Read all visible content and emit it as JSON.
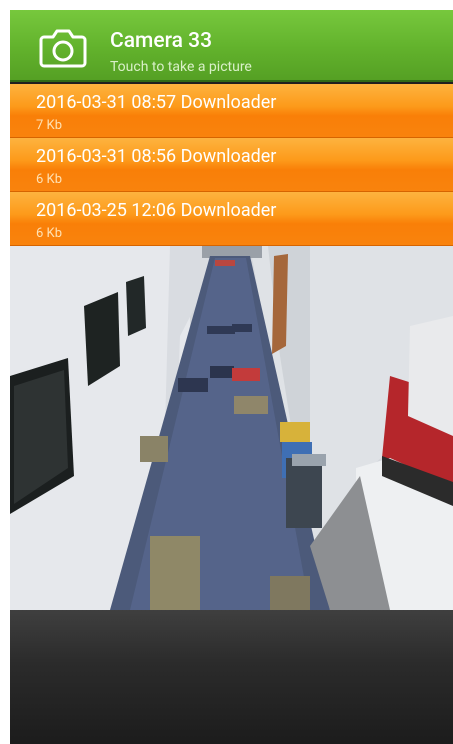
{
  "header": {
    "title": "Camera 33",
    "subtitle": "Touch to take a picture",
    "icon": "camera-icon"
  },
  "downloads": [
    {
      "title": "2016-03-31 08:57 Downloader",
      "size": "7 Kb"
    },
    {
      "title": "2016-03-31 08:56 Downloader",
      "size": "6 Kb"
    },
    {
      "title": "2016-03-25 12:06 Downloader",
      "size": "6 Kb"
    }
  ],
  "colors": {
    "header_green": "#62b22c",
    "row_orange": "#fd9a1a",
    "bottom_dark": "#2b2b2b"
  }
}
